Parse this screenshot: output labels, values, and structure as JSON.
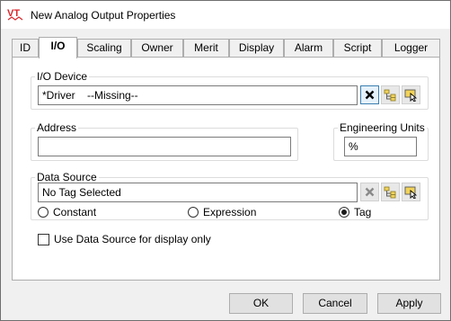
{
  "window": {
    "title": "New Analog Output Properties",
    "app_icon": "vt-logo-icon"
  },
  "tabs": [
    {
      "label": "ID",
      "active": false
    },
    {
      "label": "I/O",
      "active": true
    },
    {
      "label": "Scaling",
      "active": false
    },
    {
      "label": "Owner",
      "active": false
    },
    {
      "label": "Merit",
      "active": false
    },
    {
      "label": "Display",
      "active": false
    },
    {
      "label": "Alarm",
      "active": false
    },
    {
      "label": "Script",
      "active": false
    },
    {
      "label": "Logger",
      "active": false
    }
  ],
  "io_device": {
    "label": "I/O Device",
    "value": "*Driver    --Missing--",
    "icons": [
      "clear-icon",
      "tree-browse-icon",
      "select-icon"
    ]
  },
  "address": {
    "label": "Address",
    "value": ""
  },
  "engineering_units": {
    "label": "Engineering Units",
    "value": "%"
  },
  "data_source": {
    "label": "Data Source",
    "value": "No Tag Selected",
    "icons": [
      "clear-icon",
      "tree-browse-icon",
      "select-icon"
    ],
    "options": [
      {
        "label": "Constant",
        "selected": false
      },
      {
        "label": "Expression",
        "selected": false
      },
      {
        "label": "Tag",
        "selected": true
      }
    ]
  },
  "display_only": {
    "label": "Use Data Source for display only",
    "checked": false
  },
  "buttons": {
    "ok": "OK",
    "cancel": "Cancel",
    "apply": "Apply"
  },
  "colors": {
    "focus_border": "#3c7fb1",
    "logo_red": "#d9262b"
  }
}
